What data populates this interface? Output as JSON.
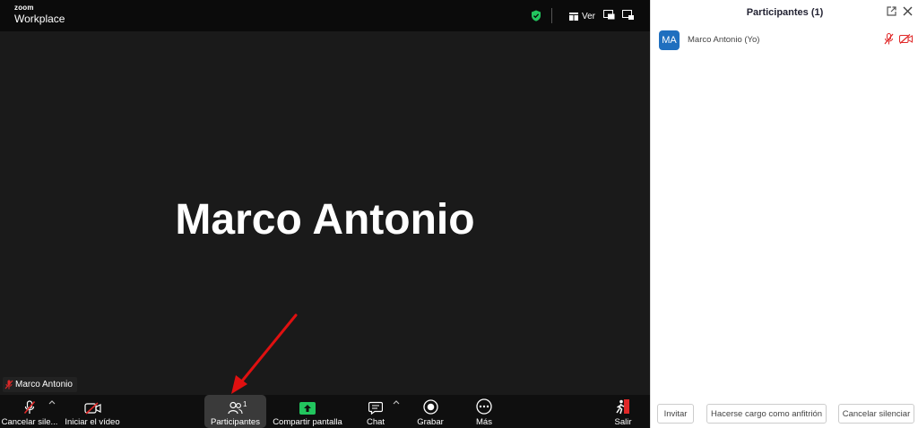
{
  "app": {
    "logo_top": "zoom",
    "logo_bottom": "Workplace"
  },
  "topbar": {
    "view_label": "Ver",
    "icons": [
      "shield-check-icon",
      "view-grid-icon",
      "pip-icon",
      "fullscreen-icon"
    ]
  },
  "stage": {
    "speaker_name": "Marco Antonio",
    "name_tag": "Marco Antonio"
  },
  "toolbar": {
    "unmute_label": "Cancelar sile...",
    "start_video_label": "Iniciar el vídeo",
    "participants_label": "Participantes",
    "participants_count": "1",
    "share_label": "Compartir pantalla",
    "chat_label": "Chat",
    "record_label": "Grabar",
    "more_label": "Más",
    "leave_label": "Salir"
  },
  "panel": {
    "title": "Participantes (1)",
    "participants": [
      {
        "initials": "MA",
        "name": "Marco Antonio (Yo)",
        "muted": true,
        "video_off": true
      }
    ],
    "invite_label": "Invitar",
    "host_label": "Hacerse cargo como anfitrión",
    "unmute_label": "Cancelar silenciar"
  },
  "colors": {
    "meeting_bg": "#1a1a1a",
    "toolbar_bg": "#0f0f0f",
    "muted_red": "#e02828",
    "share_green": "#22c55e",
    "avatar_blue": "#1f6fbf",
    "arrow_red": "#e01010"
  }
}
